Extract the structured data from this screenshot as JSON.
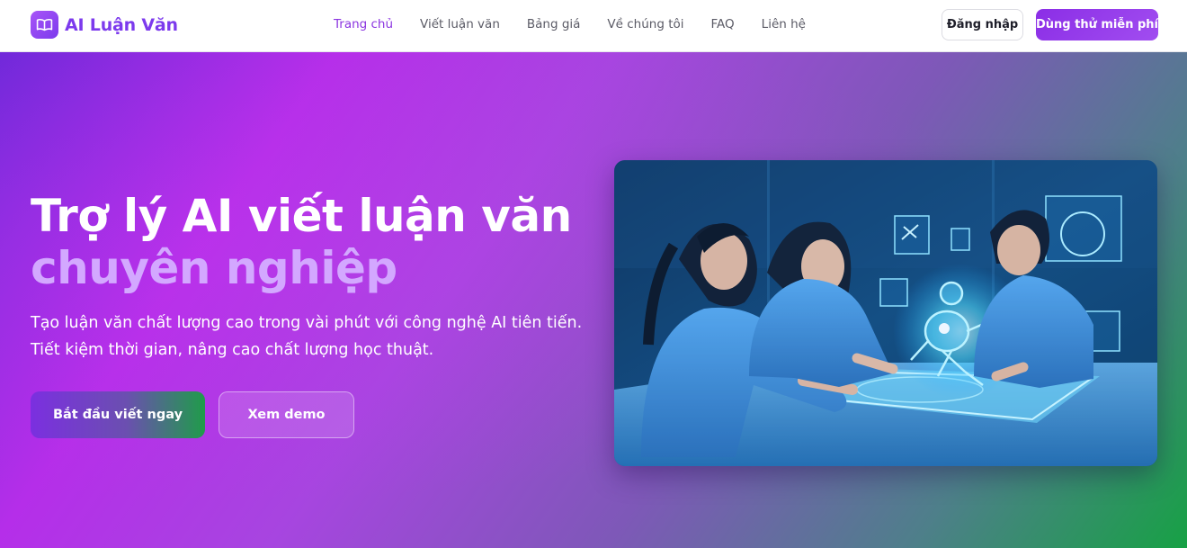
{
  "brand": {
    "name": "AI Luận Văn",
    "logo_icon": "book-open-icon",
    "accent": "#7c3aed"
  },
  "nav": {
    "links": [
      {
        "label": "Trang chủ",
        "active": true
      },
      {
        "label": "Viết luận văn",
        "active": false
      },
      {
        "label": "Bảng giá",
        "active": false
      },
      {
        "label": "Về chúng tôi",
        "active": false
      },
      {
        "label": "FAQ",
        "active": false
      },
      {
        "label": "Liên hệ",
        "active": false
      }
    ],
    "login_label": "Đăng nhập",
    "trial_label": "Dùng thử miễn phí"
  },
  "hero": {
    "title_line1": "Trợ lý AI viết luận văn",
    "title_line2": "chuyên nghiệp",
    "subtitle_line1": "Tạo luận văn chất lượng cao trong vài phút với công nghệ AI tiên tiến.",
    "subtitle_line2": "Tiết kiệm thời gian, nâng cao chất lượng học thuật.",
    "primary_cta": "Bắt đầu viết ngay",
    "secondary_cta": "Xem demo"
  },
  "colors": {
    "hero_gradient_start": "#6d28d9",
    "hero_gradient_mid": "#b52ee9",
    "hero_gradient_end": "#17a145",
    "title_highlight": "#d3a8ff",
    "nav_active": "#8b35e0"
  }
}
